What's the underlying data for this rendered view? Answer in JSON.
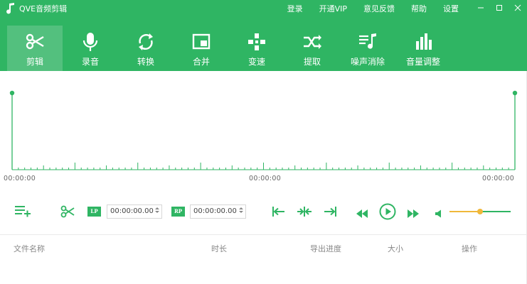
{
  "app": {
    "title": "QVE音频剪辑",
    "brand_color": "#2fb563",
    "accent_color": "#f0b83a"
  },
  "titlebar": {
    "links": [
      "登录",
      "开通VIP",
      "意见反馈",
      "帮助",
      "设置"
    ],
    "window_controls": [
      "minimize-icon",
      "maximize-icon",
      "close-icon"
    ]
  },
  "toolbar": {
    "items": [
      {
        "label": "剪辑",
        "icon": "scissors-icon",
        "active": true
      },
      {
        "label": "录音",
        "icon": "microphone-icon",
        "active": false
      },
      {
        "label": "转换",
        "icon": "convert-icon",
        "active": false
      },
      {
        "label": "合并",
        "icon": "merge-icon",
        "active": false
      },
      {
        "label": "变速",
        "icon": "speed-icon",
        "active": false
      },
      {
        "label": "提取",
        "icon": "extract-icon",
        "active": false
      },
      {
        "label": "噪声消除",
        "icon": "noise-removal-icon",
        "active": false
      },
      {
        "label": "音量调整",
        "icon": "volume-adjust-icon",
        "active": false
      }
    ]
  },
  "timeline": {
    "start": "00:00:00",
    "middle": "00:00:00",
    "end": "00:00:00"
  },
  "controls": {
    "lp_label": "LP",
    "lp_time": "00:00:00.00",
    "rp_label": "RP",
    "rp_time": "00:00:00.00",
    "volume_level": 0.5
  },
  "file_list": {
    "columns": [
      "文件名称",
      "时长",
      "导出进度",
      "大小",
      "操作"
    ]
  }
}
